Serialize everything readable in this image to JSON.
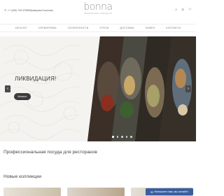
{
  "header": {
    "phone": "+7 (495) 790-67-67",
    "city": "Абрамцево/Сазоново",
    "logo_word": "bonna",
    "logo_sub": "PROFESSIONAL PORCELAIN",
    "icons": [
      "search-icon",
      "user-icon",
      "cart-icon"
    ]
  },
  "nav": {
    "items": [
      "Каталог",
      "Сервировка",
      "Особенности",
      "Отели",
      "Доставка",
      "Обмен",
      "Контакты"
    ]
  },
  "hero": {
    "title": "ЛИКВИДАЦИЯ!",
    "button_label": "Каталог",
    "arrow_left": "‹",
    "arrow_right": "›",
    "active_slide": 0,
    "slide_count": 5
  },
  "main": {
    "tagline": "Профессиональная посуда для ресторанов",
    "collections_title": "Новые коллекции"
  },
  "chat": {
    "label": "Напишите нам, мы онлайн!"
  },
  "colors": {
    "accent": "#3a5fa0",
    "dark_button": "#3c3c3c"
  }
}
